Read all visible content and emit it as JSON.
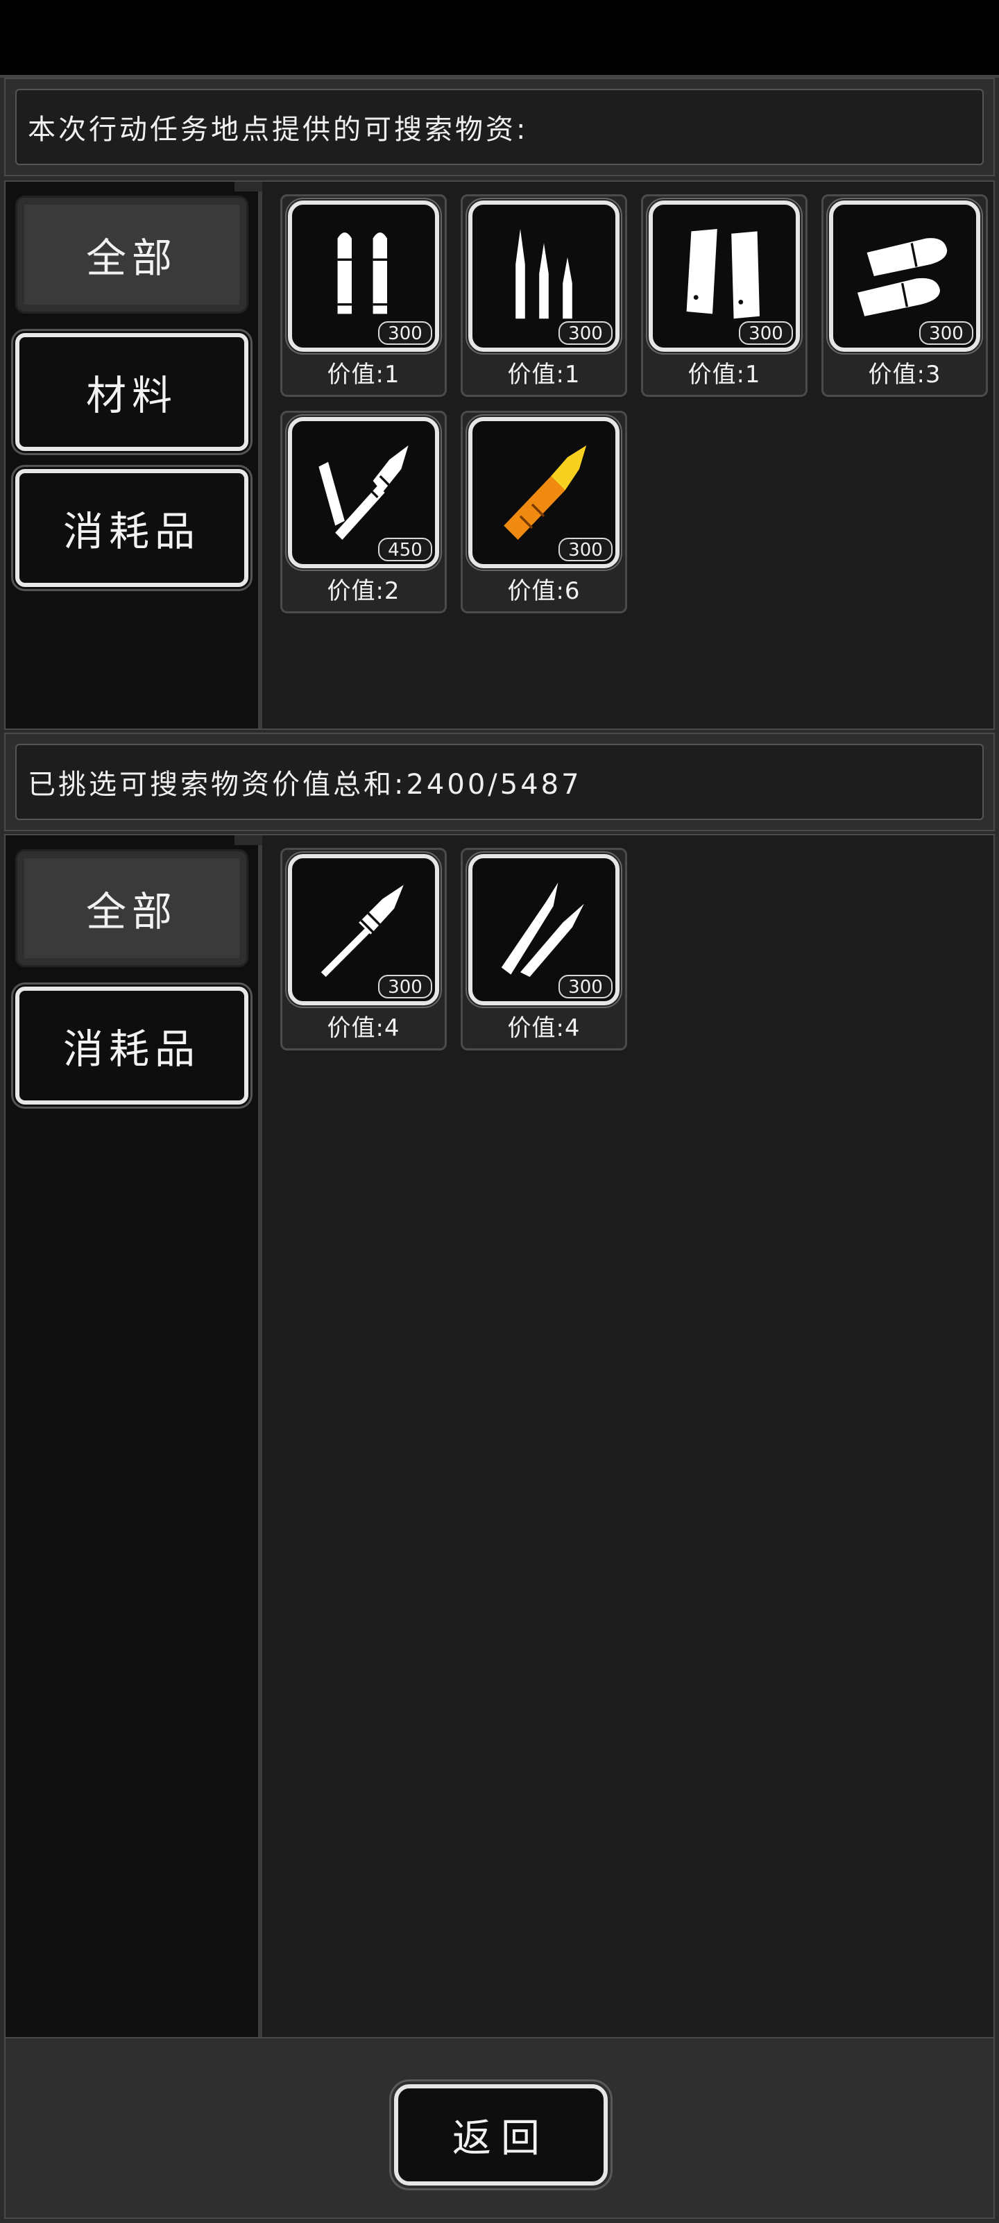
{
  "top_section": {
    "header": "本次行动任务地点提供的可搜索物资:",
    "tabs": [
      {
        "label": "全部",
        "active": true
      },
      {
        "label": "材料",
        "active": false
      },
      {
        "label": "消耗品",
        "active": false
      }
    ],
    "items": [
      {
        "icon": "pistol-ammo-icon",
        "qty": "300",
        "value": "价值:1",
        "color": "#ffffff"
      },
      {
        "icon": "rifle-ammo-icon",
        "qty": "300",
        "value": "价值:1",
        "color": "#ffffff"
      },
      {
        "icon": "shotgun-shells-icon",
        "qty": "300",
        "value": "价值:1",
        "color": "#ffffff"
      },
      {
        "icon": "heavy-bullets-icon",
        "qty": "300",
        "value": "价值:3",
        "color": "#ffffff"
      },
      {
        "icon": "rocket-parts-icon",
        "qty": "450",
        "value": "价值:2",
        "color": "#ffffff"
      },
      {
        "icon": "orange-rocket-icon",
        "qty": "300",
        "value": "价值:6",
        "color": "#f5a020"
      }
    ]
  },
  "bottom_section": {
    "header": "已挑选可搜索物资价值总和:2400/5487",
    "tabs": [
      {
        "label": "全部",
        "active": true
      },
      {
        "label": "消耗品",
        "active": false
      }
    ],
    "items": [
      {
        "icon": "rocket-shell-icon",
        "qty": "300",
        "value": "价值:4",
        "color": "#ffffff"
      },
      {
        "icon": "sniper-rounds-icon",
        "qty": "300",
        "value": "价值:4",
        "color": "#ffffff"
      }
    ]
  },
  "footer": {
    "back_label": "返回"
  }
}
